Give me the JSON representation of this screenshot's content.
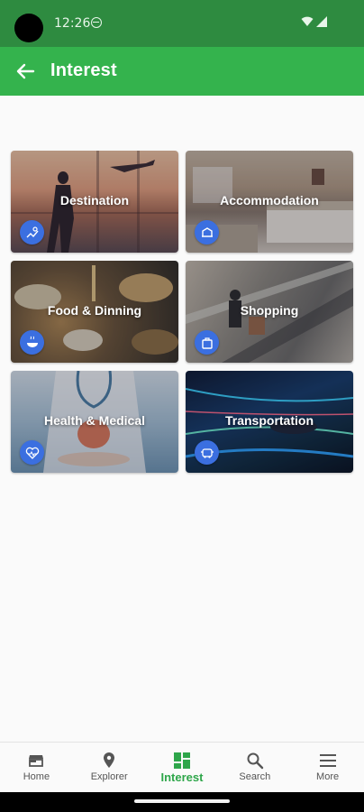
{
  "status_bar": {
    "time": "12:26",
    "icons": [
      "camera-cutout",
      "sync-icon",
      "wifi-icon",
      "signal-icon"
    ]
  },
  "app_bar": {
    "title": "Interest",
    "back_icon": "arrow-left-icon",
    "color": "#34b34d"
  },
  "categories": [
    {
      "label": "Destination",
      "icon": "map-icon"
    },
    {
      "label": "Accommodation",
      "icon": "hotel-icon"
    },
    {
      "label": "Food & Dinning",
      "icon": "food-icon"
    },
    {
      "label": "Shopping",
      "icon": "shopping-bag-icon"
    },
    {
      "label": "Health & Medical",
      "icon": "heartbeat-icon"
    },
    {
      "label": "Transportation",
      "icon": "car-icon"
    }
  ],
  "bottom_nav": [
    {
      "label": "Home",
      "icon": "store-icon",
      "active": false
    },
    {
      "label": "Explorer",
      "icon": "location-pin-icon",
      "active": false
    },
    {
      "label": "Interest",
      "icon": "grid-icon",
      "active": true
    },
    {
      "label": "Search",
      "icon": "search-icon",
      "active": false
    },
    {
      "label": "More",
      "icon": "menu-icon",
      "active": false
    }
  ],
  "colors": {
    "status_bar": "#2e8b40",
    "accent": "#34b34d",
    "active_nav": "#2ea64a",
    "card_icon": "#3b6fe0"
  }
}
